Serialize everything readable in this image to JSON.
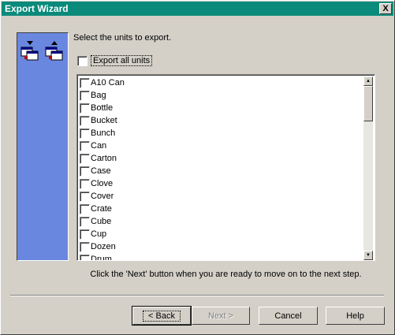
{
  "window": {
    "title": "Export Wizard",
    "close_label": "X"
  },
  "page": {
    "instruction": "Select the units to export.",
    "export_all_label": "Export all units",
    "hint": "Click the 'Next' button when you are ready to move on to the next step."
  },
  "units": [
    "A10 Can",
    "Bag",
    "Bottle",
    "Bucket",
    "Bunch",
    "Can",
    "Carton",
    "Case",
    "Clove",
    "Cover",
    "Crate",
    "Cube",
    "Cup",
    "Dozen",
    "Drum"
  ],
  "buttons": {
    "back": "< Back",
    "next": "Next >",
    "cancel": "Cancel",
    "help": "Help"
  },
  "colors": {
    "titlebar": "#0a8a7a",
    "side_panel": "#6a87e0",
    "dialog_bg": "#d4d0c8"
  },
  "icons": {
    "wizard": "export-files-icon"
  }
}
